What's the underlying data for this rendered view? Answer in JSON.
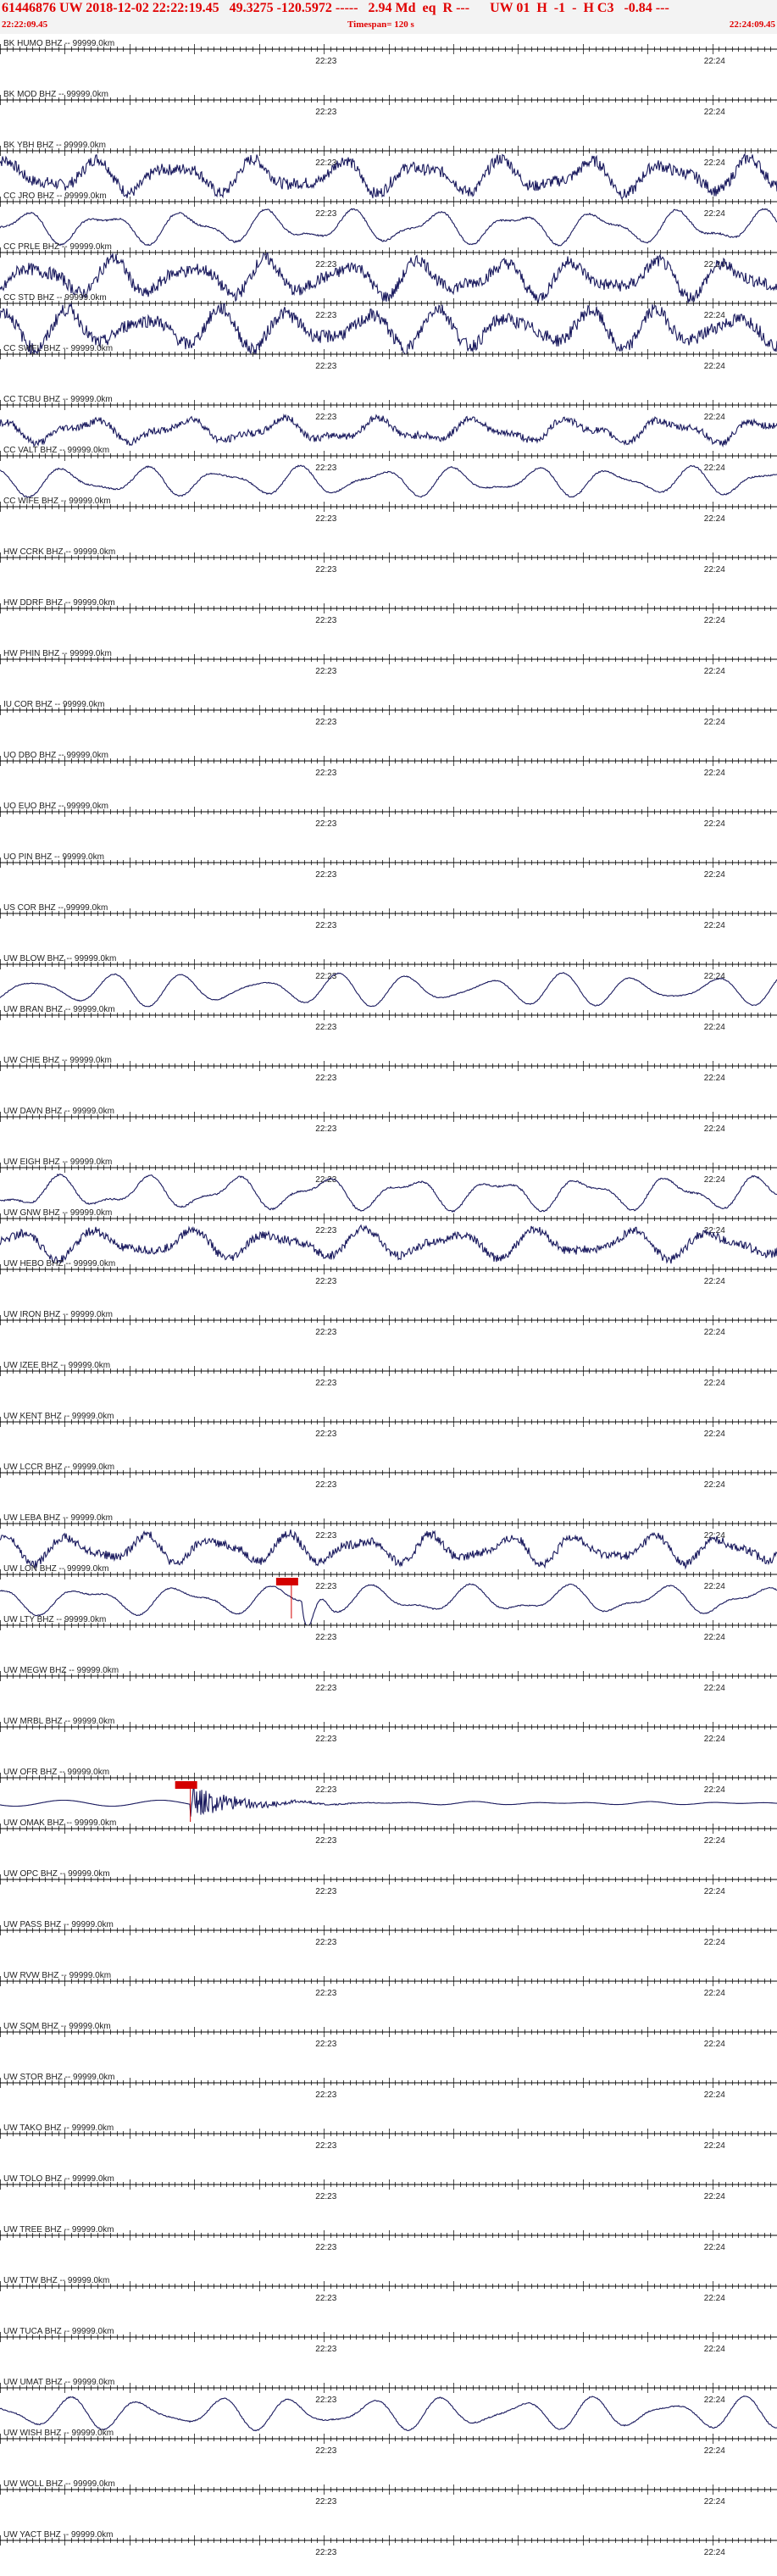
{
  "header": {
    "event_line": "61446876 UW 2018-12-02 22:22:19.45   49.3275 -120.5972 -----   2.94 Md  eq  R ---      UW 01  H  -1  -  H C3   -0.84 ---",
    "start_time": "22:22:09.45",
    "timespan": "Timespan= 120 s",
    "end_time": "22:24:09.45"
  },
  "tick_labels": {
    "mid": "22:23",
    "right": "22:24"
  },
  "colors": {
    "header_text": "#e00000",
    "trace": "#1a1a5e",
    "pick": "#d40000",
    "axis": "#000000"
  },
  "channels": [
    {
      "label": "BK HUMO BHZ -- 99999.0km",
      "active": false
    },
    {
      "label": "BK MOD BHZ -- 99999.0km",
      "active": false
    },
    {
      "label": "BK YBH BHZ -- 99999.0km",
      "active": true,
      "noise": 0.35,
      "amp": 0.7
    },
    {
      "label": "CC JRO BHZ -- 99999.0km",
      "active": true,
      "noise": 0.05,
      "amp": 0.7
    },
    {
      "label": "CC PRLE BHZ -- 99999.0km",
      "active": true,
      "noise": 0.35,
      "amp": 0.75
    },
    {
      "label": "CC STD BHZ -- 99999.0km",
      "active": true,
      "noise": 0.35,
      "amp": 0.8
    },
    {
      "label": "CC SWFL BHZ -- 99999.0km",
      "active": false
    },
    {
      "label": "CC TCBU BHZ -- 99999.0km",
      "active": true,
      "noise": 0.3,
      "amp": 0.5
    },
    {
      "label": "CC VALT BHZ -- 99999.0km",
      "active": true,
      "noise": 0.05,
      "amp": 0.6
    },
    {
      "label": "CC WIFE BHZ -- 99999.0km",
      "active": false
    },
    {
      "label": "HW CCRK BHZ -- 99999.0km",
      "active": false
    },
    {
      "label": "HW DDRF BHZ -- 99999.0km",
      "active": false
    },
    {
      "label": "HW PHIN BHZ -- 99999.0km",
      "active": false
    },
    {
      "label": "IU COR BHZ -- 99999.0km",
      "active": false
    },
    {
      "label": "UO DBO BHZ -- 99999.0km",
      "active": false
    },
    {
      "label": "UO EUO BHZ -- 99999.0km",
      "active": false
    },
    {
      "label": "UO PIN BHZ -- 99999.0km",
      "active": false
    },
    {
      "label": "US COR BHZ -- 99999.0km",
      "active": false
    },
    {
      "label": "UW BLOW BHZ -- 99999.0km",
      "active": true,
      "noise": 0.03,
      "amp": 0.65
    },
    {
      "label": "UW BRAN BHZ -- 99999.0km",
      "active": false
    },
    {
      "label": "UW CHIE BHZ -- 99999.0km",
      "active": false
    },
    {
      "label": "UW DAVN BHZ -- 99999.0km",
      "active": false
    },
    {
      "label": "UW EIGH BHZ -- 99999.0km",
      "active": true,
      "noise": 0.05,
      "amp": 0.7
    },
    {
      "label": "UW GNW BHZ -- 99999.0km",
      "active": true,
      "noise": 0.3,
      "amp": 0.6
    },
    {
      "label": "UW HEBO BHZ -- 99999.0km",
      "active": false
    },
    {
      "label": "UW IRON BHZ -- 99999.0km",
      "active": false
    },
    {
      "label": "UW IZEE BHZ -- 99999.0km",
      "active": false
    },
    {
      "label": "UW KENT BHZ -- 99999.0km",
      "active": false
    },
    {
      "label": "UW LCCR BHZ -- 99999.0km",
      "active": false
    },
    {
      "label": "UW LEBA BHZ -- 99999.0km",
      "active": true,
      "noise": 0.3,
      "amp": 0.6
    },
    {
      "label": "UW LON BHZ -- 99999.0km",
      "active": true,
      "noise": 0.04,
      "amp": 0.6,
      "pick": 0.375,
      "pick_spike": true
    },
    {
      "label": "UW LTY BHZ -- 99999.0km",
      "active": false
    },
    {
      "label": "UW MEGW BHZ -- 99999.0km",
      "active": false
    },
    {
      "label": "UW MRBL BHZ -- 99999.0km",
      "active": false
    },
    {
      "label": "UW OFR BHZ -- 99999.0km",
      "active": true,
      "noise": 0.02,
      "amp": 0.18,
      "pick": 0.245,
      "quake": true
    },
    {
      "label": "UW OMAK BHZ -- 99999.0km",
      "active": false
    },
    {
      "label": "UW OPC BHZ -- 99999.0km",
      "active": false
    },
    {
      "label": "UW PASS BHZ -- 99999.0km",
      "active": false
    },
    {
      "label": "UW RVW BHZ -- 99999.0km",
      "active": false
    },
    {
      "label": "UW SQM BHZ -- 99999.0km",
      "active": false
    },
    {
      "label": "UW STOR BHZ -- 99999.0km",
      "active": false
    },
    {
      "label": "UW TAKO BHZ -- 99999.0km",
      "active": false
    },
    {
      "label": "UW TOLO BHZ -- 99999.0km",
      "active": false
    },
    {
      "label": "UW TREE BHZ -- 99999.0km",
      "active": false
    },
    {
      "label": "UW TTW BHZ -- 99999.0km",
      "active": false
    },
    {
      "label": "UW TUCA BHZ -- 99999.0km",
      "active": false
    },
    {
      "label": "UW UMAT BHZ -- 99999.0km",
      "active": true,
      "noise": 0.04,
      "amp": 0.65
    },
    {
      "label": "UW WISH BHZ -- 99999.0km",
      "active": false
    },
    {
      "label": "UW WOLL BHZ -- 99999.0km",
      "active": false
    },
    {
      "label": "UW YACT BHZ -- 99999.0km",
      "active": false
    }
  ]
}
